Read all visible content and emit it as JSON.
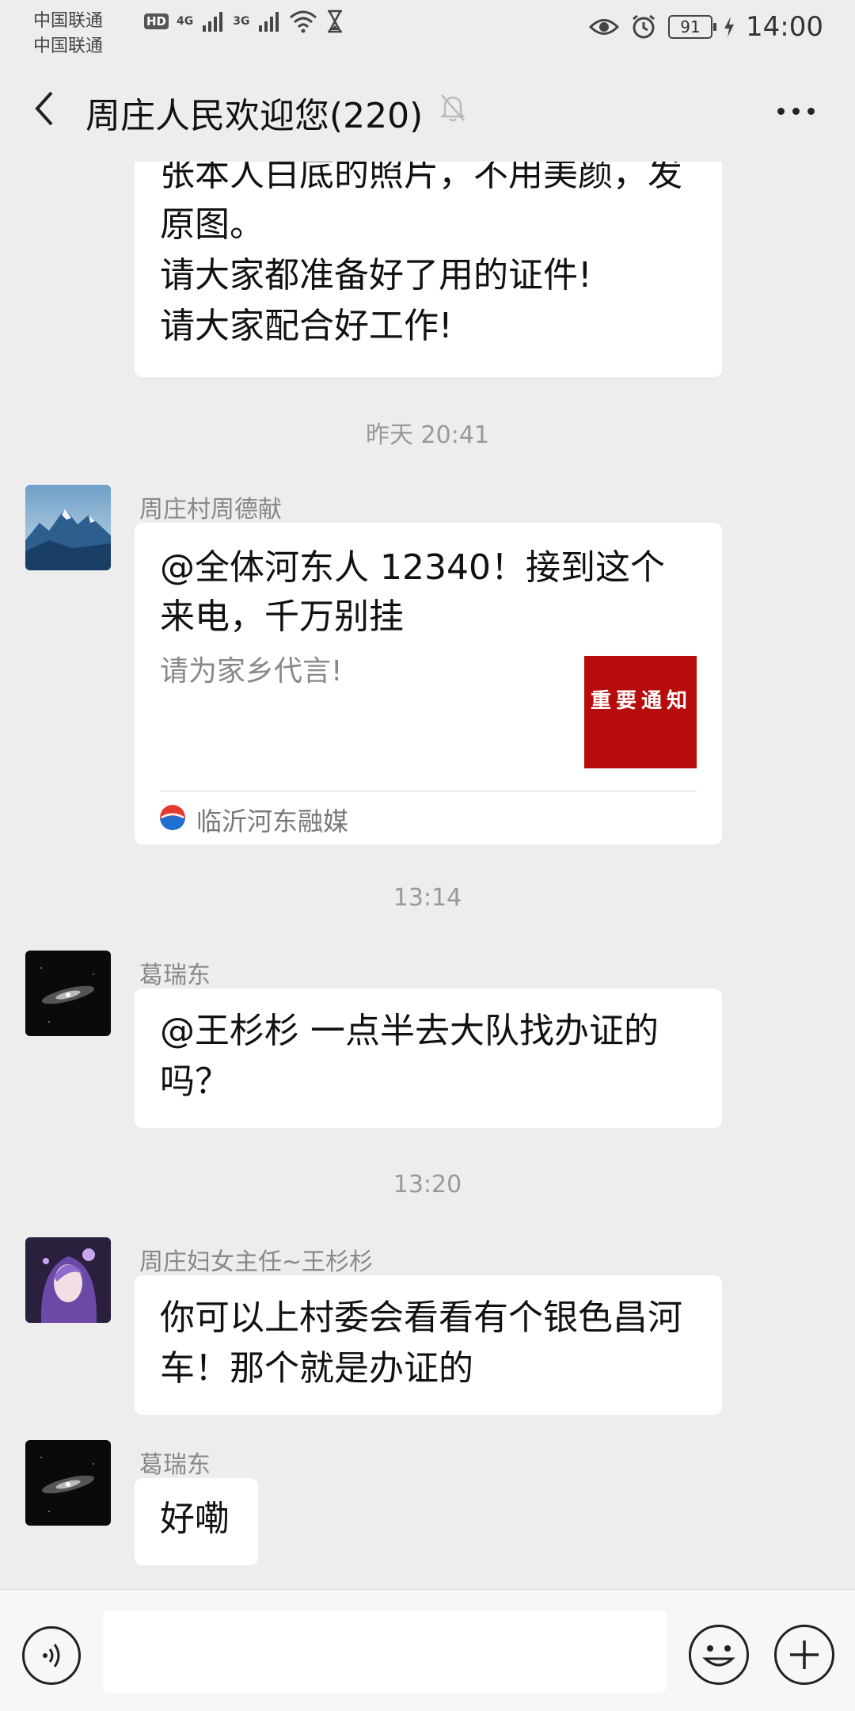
{
  "status_bar": {
    "carrier1": "中国联通",
    "carrier2": "中国联通",
    "hd": "HD",
    "net1": "4G",
    "net2": "3G",
    "battery": "91",
    "time": "14:00"
  },
  "header": {
    "title": "周庄人民欢迎您(220)"
  },
  "messages": {
    "m1_line1": "张本人白底的照片，不用美颜，发",
    "m1_line2": "原图。",
    "m1_line3": "请大家都准备好了用的证件!",
    "m1_line4": "请大家配合好工作!",
    "ts1": "昨天 20:41",
    "m2_sender": "周庄村周德献",
    "m2_card_title": "@全体河东人 12340！接到这个来电，千万别挂",
    "m2_card_desc": "请为家乡代言!",
    "m2_card_thumb_text": "重要通知",
    "m2_card_source": "临沂河东融媒",
    "ts2": "13:14",
    "m3_sender": "葛瑞东",
    "m3_text": "@王杉杉  一点半去大队找办证的吗？",
    "ts3": "13:20",
    "m4_sender": "周庄妇女主任~王杉杉",
    "m4_text": "你可以上村委会看看有个银色昌河车！那个就是办证的",
    "m5_sender": "葛瑞东",
    "m5_text": "好嘞"
  },
  "input_bar": {
    "placeholder": ""
  },
  "icons": {
    "back": "back-arrow-icon",
    "mute": "bell-off-icon",
    "more": "more-dots-icon",
    "voice": "voice-icon",
    "emoji": "emoji-icon",
    "plus": "plus-icon"
  }
}
